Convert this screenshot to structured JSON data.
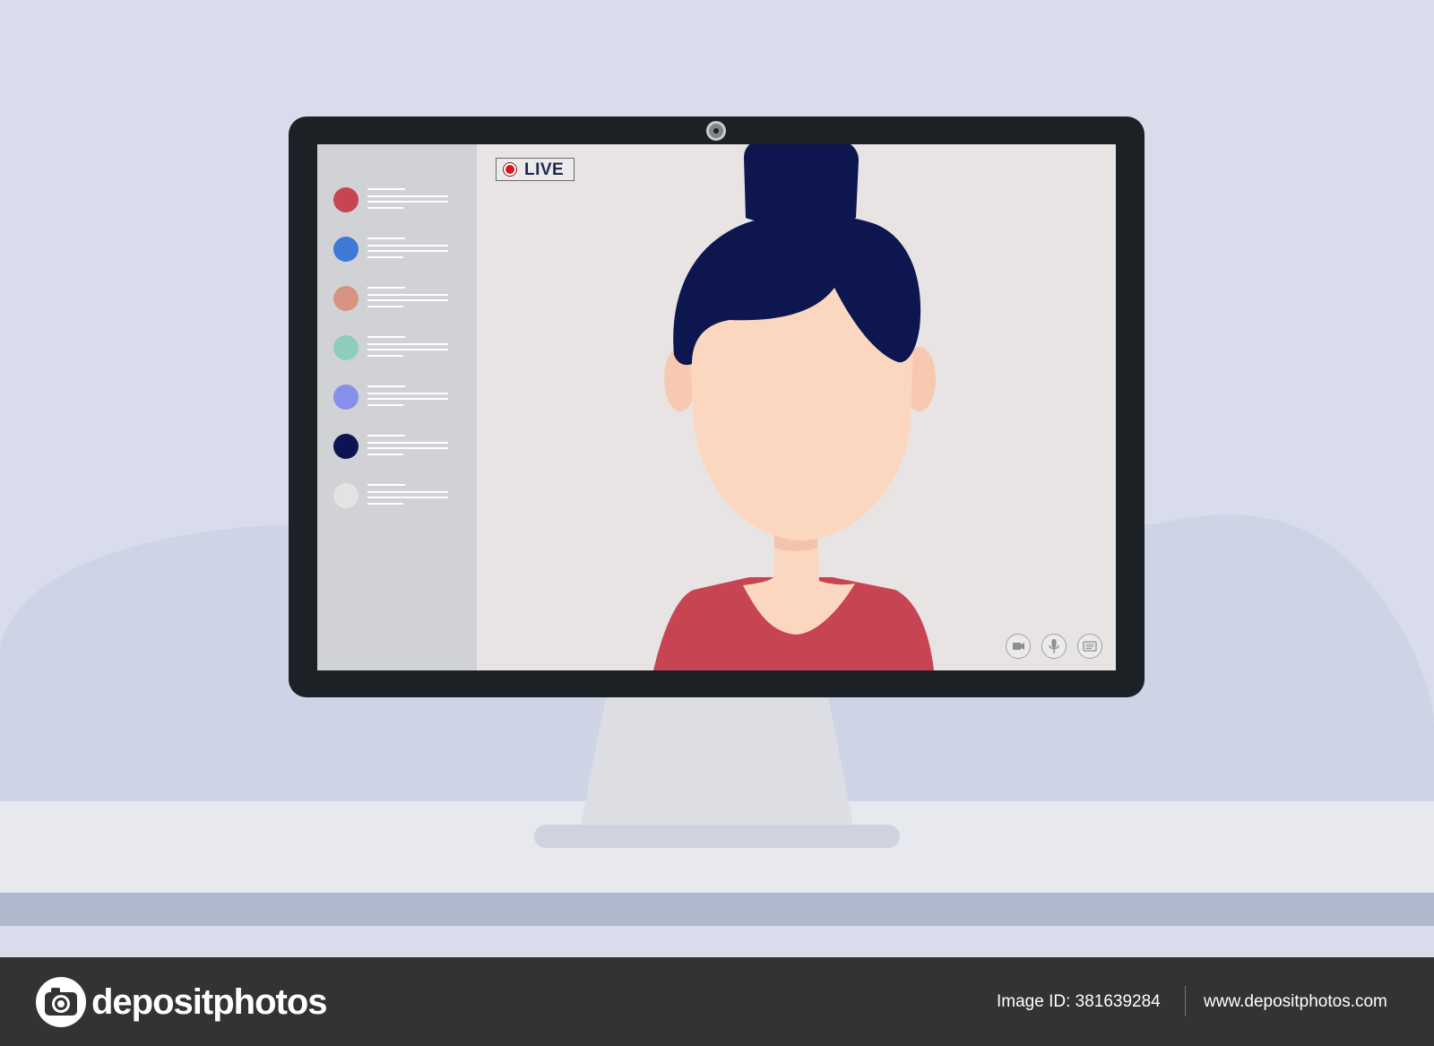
{
  "scene": {
    "background_color": "#d9dceb",
    "desk_color": "#e8e9ef"
  },
  "screen": {
    "live_label": "LIVE",
    "contacts": [
      {
        "color": "#c74453"
      },
      {
        "color": "#3e79d6"
      },
      {
        "color": "#d89482"
      },
      {
        "color": "#8ecdbb"
      },
      {
        "color": "#8690ea"
      },
      {
        "color": "#0d1450"
      },
      {
        "color": "#e5e3e2"
      }
    ],
    "controls": [
      {
        "icon": "video-camera-icon"
      },
      {
        "icon": "microphone-icon"
      },
      {
        "icon": "chat-icon"
      }
    ],
    "person": {
      "hair_color": "#0e1650",
      "skin_color": "#fcd7c0",
      "shirt_color": "#c74453"
    }
  },
  "footer": {
    "brand": "depositphotos",
    "image_id": "Image ID: 381639284",
    "url": "www.depositphotos.com"
  }
}
